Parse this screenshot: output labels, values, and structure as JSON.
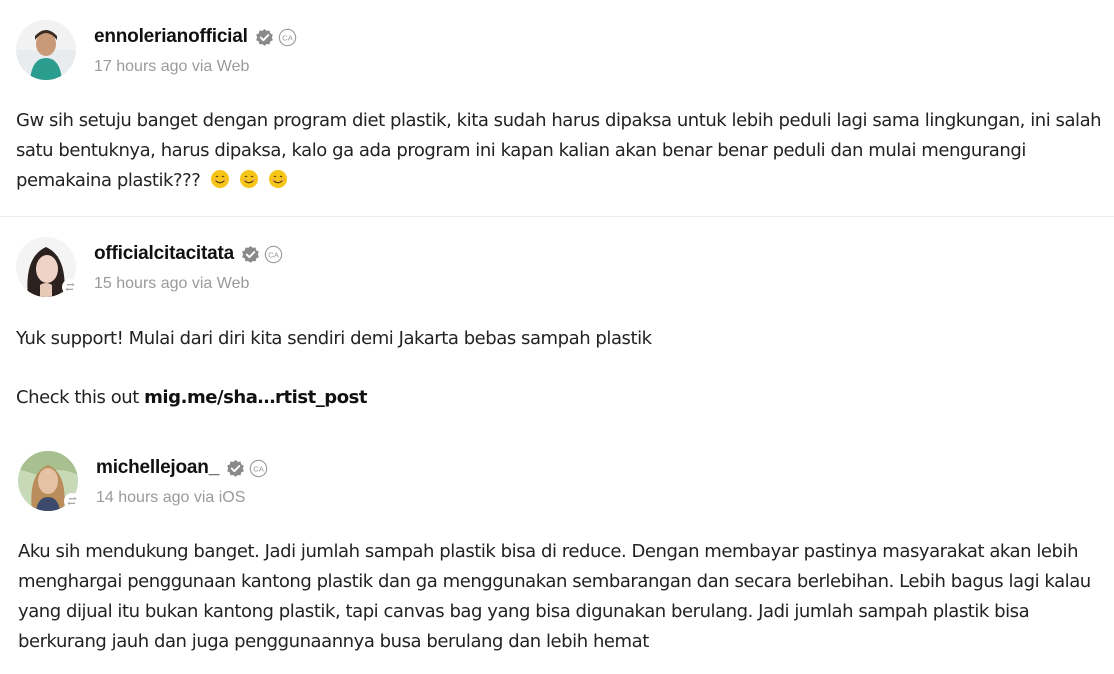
{
  "posts": [
    {
      "username": "ennolerianofficial",
      "timestamp": "17 hours ago via Web",
      "text": "Gw sih setuju banget dengan program diet plastik, kita sudah harus dipaksa untuk lebih peduli lagi sama lingkungan, ini salah satu bentuknya, harus dipaksa, kalo ga ada program ini kapan kalian akan benar benar peduli dan mulai mengurangi pemakaina plastik???",
      "emojis": [
        "smiling-face-emoji",
        "smiling-face-emoji",
        "smiling-face-emoji"
      ],
      "verified": true,
      "repost": false
    },
    {
      "username": "officialcitacitata",
      "timestamp": "15 hours ago via Web",
      "text": "Yuk support! Mulai dari diri kita sendiri demi Jakarta bebas sampah plastik",
      "check_prefix": "Check this out",
      "link": "mig.me/sha…rtist_post",
      "verified": true,
      "repost": true
    },
    {
      "username": "michellejoan_",
      "timestamp": "14 hours ago via iOS",
      "text": "Aku sih mendukung banget. Jadi jumlah sampah plastik bisa di reduce. Dengan membayar pastinya masyarakat akan lebih menghargai penggunaan kantong plastik dan ga menggunakan sembarangan dan secara berlebihan. Lebih bagus lagi kalau yang dijual itu bukan kantong plastik, tapi canvas bag yang bisa digunakan berulang. Jadi jumlah sampah plastik bisa berkurang jauh dan juga penggunaannya busa berulang dan lebih hemat",
      "verified": true,
      "repost": true
    }
  ],
  "icons": {
    "verified": "verified-badge-icon",
    "ca": "ca-badge-icon",
    "repost": "repost-icon"
  },
  "colors": {
    "username": "#111111",
    "timestamp": "#9a9a9a",
    "body": "#222222",
    "divider": "#ebebeb",
    "verified_badge": "#8a8a8a",
    "emoji": "#f5c518"
  }
}
